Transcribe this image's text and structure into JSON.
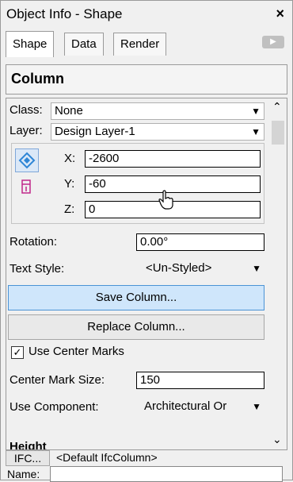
{
  "window": {
    "title": "Object Info - Shape",
    "close_glyph": "×"
  },
  "tabs": [
    {
      "label": "Shape",
      "active": true
    },
    {
      "label": "Data",
      "active": false
    },
    {
      "label": "Render",
      "active": false
    }
  ],
  "object_title": "Column",
  "fields": {
    "class_label": "Class:",
    "class_value": "None",
    "layer_label": "Layer:",
    "layer_value": "Design Layer-1",
    "x_label": "X:",
    "x_value": "-2600",
    "y_label": "Y:",
    "y_value": "-60",
    "z_label": "Z:",
    "z_value": "0",
    "rotation_label": "Rotation:",
    "rotation_value": "0.00°",
    "text_style_label": "Text Style:",
    "text_style_value": "<Un-Styled>",
    "save_button": "Save Column...",
    "replace_button": "Replace Column...",
    "use_center_marks_label": "Use Center Marks",
    "use_center_marks_checked": true,
    "center_mark_size_label": "Center Mark Size:",
    "center_mark_size_value": "150",
    "use_component_label": "Use Component:",
    "use_component_value": "Architectural Or",
    "height_label": "Height"
  },
  "bottom": {
    "ifc_button": "IFC...",
    "ifc_value": "<Default IfcColumn>",
    "name_label": "Name:",
    "name_value": ""
  },
  "colors": {
    "accent": "#4b93d5",
    "highlight": "#cfe6fb"
  },
  "icons": [
    "close-icon",
    "tab-scroll-icon",
    "scroll-up-icon",
    "scroll-down-icon",
    "dropdown-arrow-icon",
    "plan-position-icon",
    "3d-position-icon",
    "checkmark-icon",
    "hand-cursor-icon"
  ]
}
